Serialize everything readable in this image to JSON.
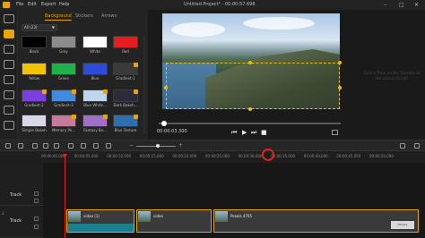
{
  "menu": {
    "file": "File",
    "edit": "Edit",
    "export": "Export",
    "help": "Help"
  },
  "window": {
    "title": "Untitled Project* - 00:00:57.698",
    "minimize": "–",
    "maximize": "□",
    "close": "✕"
  },
  "library": {
    "tabs": [
      "Background",
      "Stickers",
      "Arrows"
    ],
    "filter": "All (23)",
    "items": [
      {
        "label": "Black",
        "color": "#000000",
        "premium": false
      },
      {
        "label": "Grey",
        "color": "#8c8c8c",
        "premium": false
      },
      {
        "label": "White",
        "color": "#ffffff",
        "premium": false
      },
      {
        "label": "Red",
        "color": "#e41e1e",
        "premium": false
      },
      {
        "label": "Yellow",
        "color": "#f2c300",
        "premium": false
      },
      {
        "label": "Green",
        "color": "#1fb24a",
        "premium": false
      },
      {
        "label": "Blue",
        "color": "#2b4bd8",
        "premium": false
      },
      {
        "label": "Gradient-1",
        "color": "#3a3a3a",
        "premium": true
      },
      {
        "label": "Gradient-2",
        "color": "#7a3fe0",
        "premium": true
      },
      {
        "label": "Gradient-3",
        "color": "#3f8be0",
        "premium": true
      },
      {
        "label": "Blue White...",
        "color": "#bfd6ef",
        "premium": true
      },
      {
        "label": "Dark Bokeh...",
        "color": "#2b2b3a",
        "premium": true
      },
      {
        "label": "Simple Bokeh",
        "color": "#d8d8e8",
        "premium": false
      },
      {
        "label": "Memory Pe...",
        "color": "#c77a9a",
        "premium": true
      },
      {
        "label": "Fantasy Bo...",
        "color": "#a070c8",
        "premium": true
      },
      {
        "label": "Blue Texture",
        "color": "#2f6fb0",
        "premium": true
      }
    ]
  },
  "preview": {
    "hint": "Click a Track on the Timeline or the canvas to edit",
    "time": "00:00:03.300",
    "progress": 0.03
  },
  "ruler": {
    "ticks": [
      "00:00:00.000",
      "00:00:05.000",
      "00:00:10.000",
      "00:00:15.000",
      "00:00:20.000",
      "00:00:25.000",
      "00:00:30.000",
      "00:00:35.000",
      "00:00:40.000",
      "00:00:45.000",
      "00:00:50.000"
    ]
  },
  "tracks": [
    {
      "number": "",
      "label": "Track"
    },
    {
      "number": "2",
      "label": "Track"
    }
  ],
  "clips": [
    {
      "label": "video (1)"
    },
    {
      "label": "video"
    },
    {
      "label": "Pexels 4705"
    }
  ],
  "watermark": "Filmora"
}
